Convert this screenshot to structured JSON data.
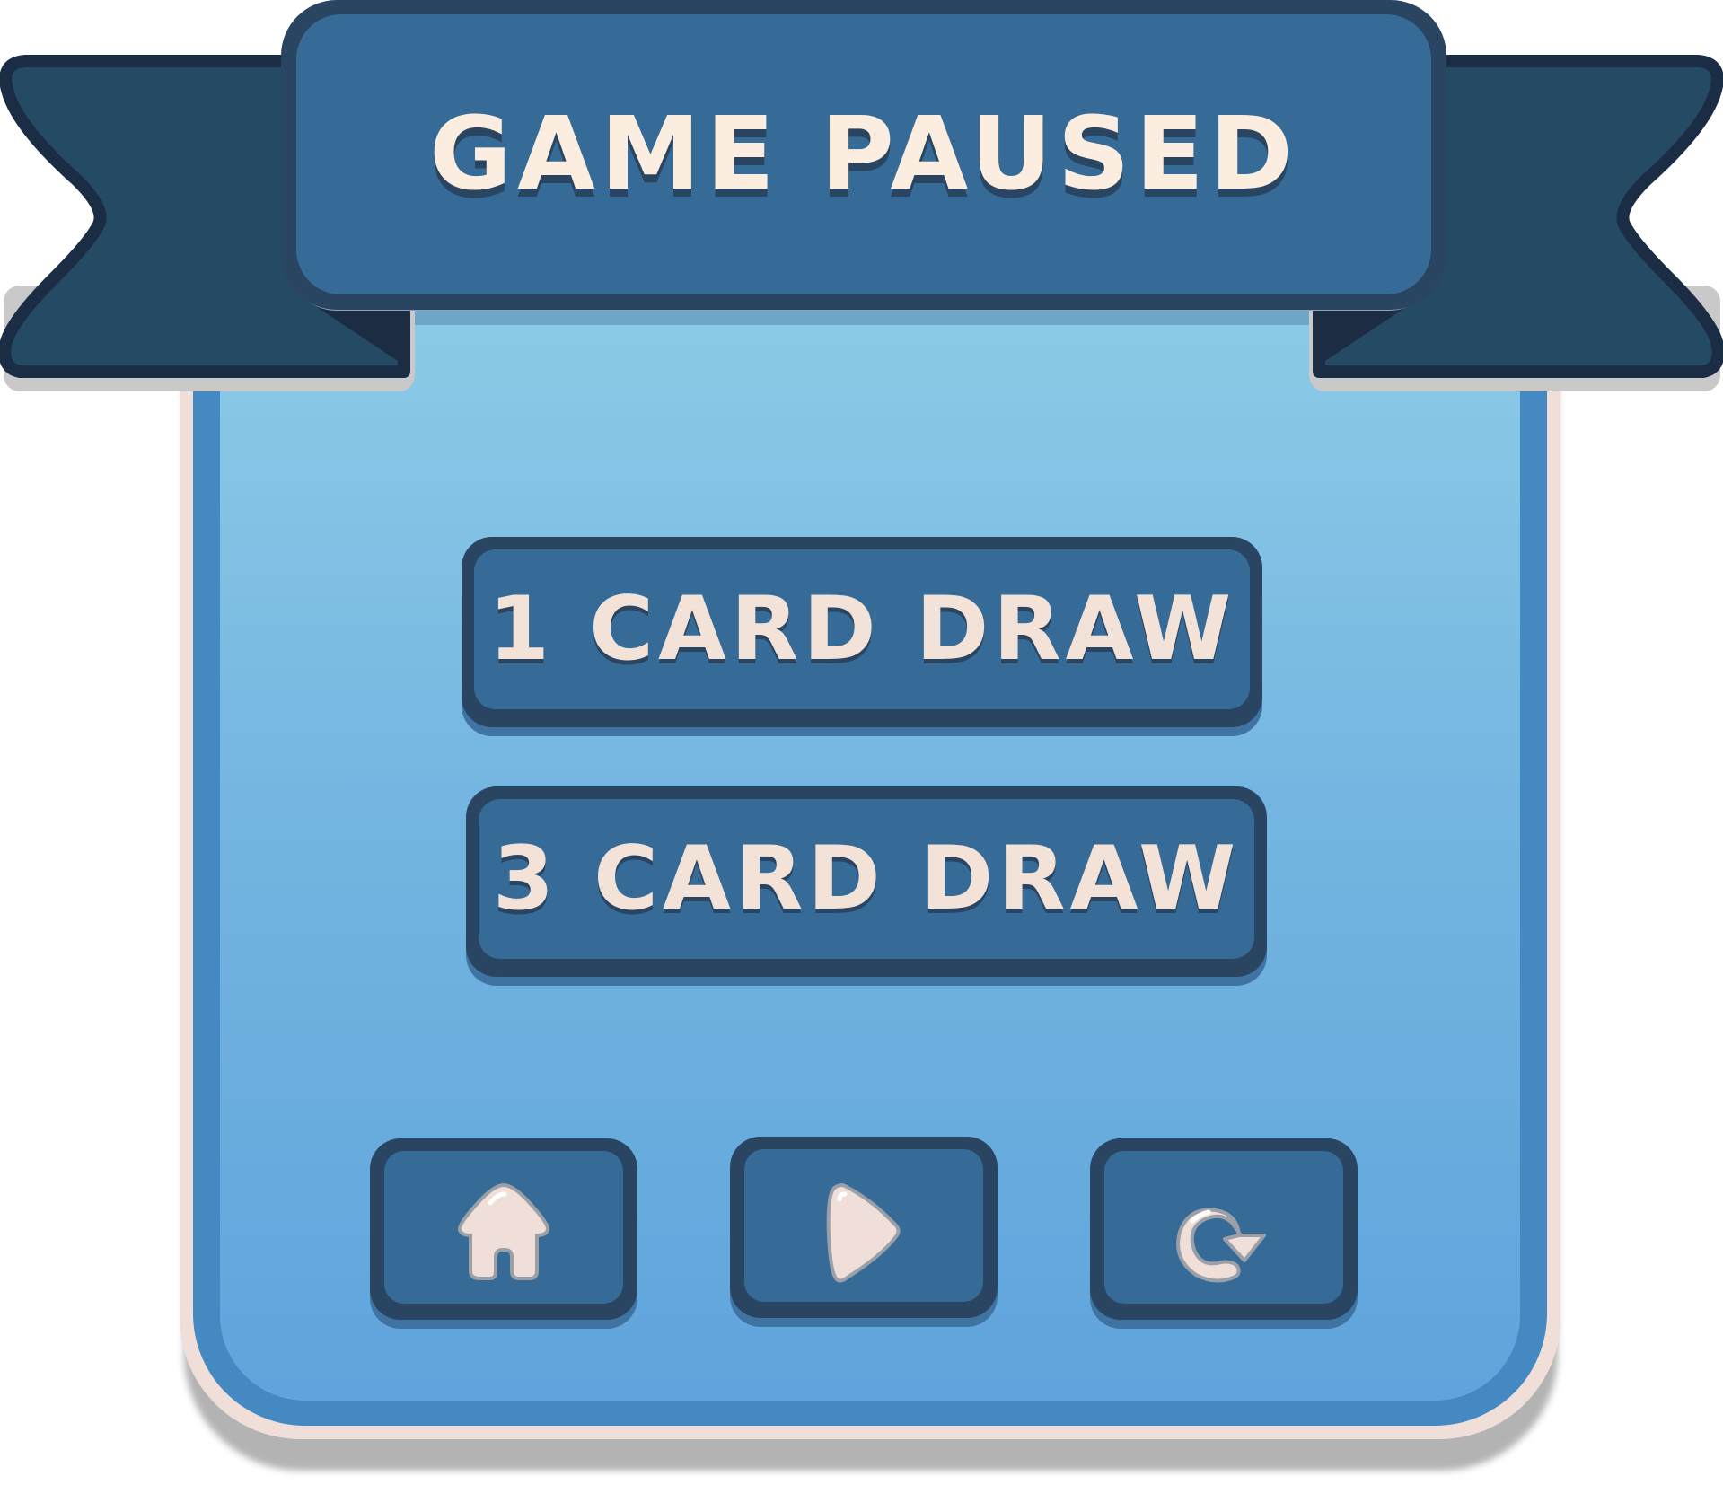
{
  "dialog": {
    "title": "GAME PAUSED"
  },
  "menu": {
    "option_one": "1 CARD DRAW",
    "option_three": "3 CARD DRAW"
  },
  "controls": {
    "home_icon": "home-icon",
    "play_icon": "play-icon",
    "restart_icon": "restart-icon"
  },
  "colors": {
    "banner": "#356b96",
    "banner_outline": "#2a4562",
    "panel_top": "#8ccbe6",
    "panel_bottom": "#5fa4dc",
    "text": "#fbeee0"
  }
}
